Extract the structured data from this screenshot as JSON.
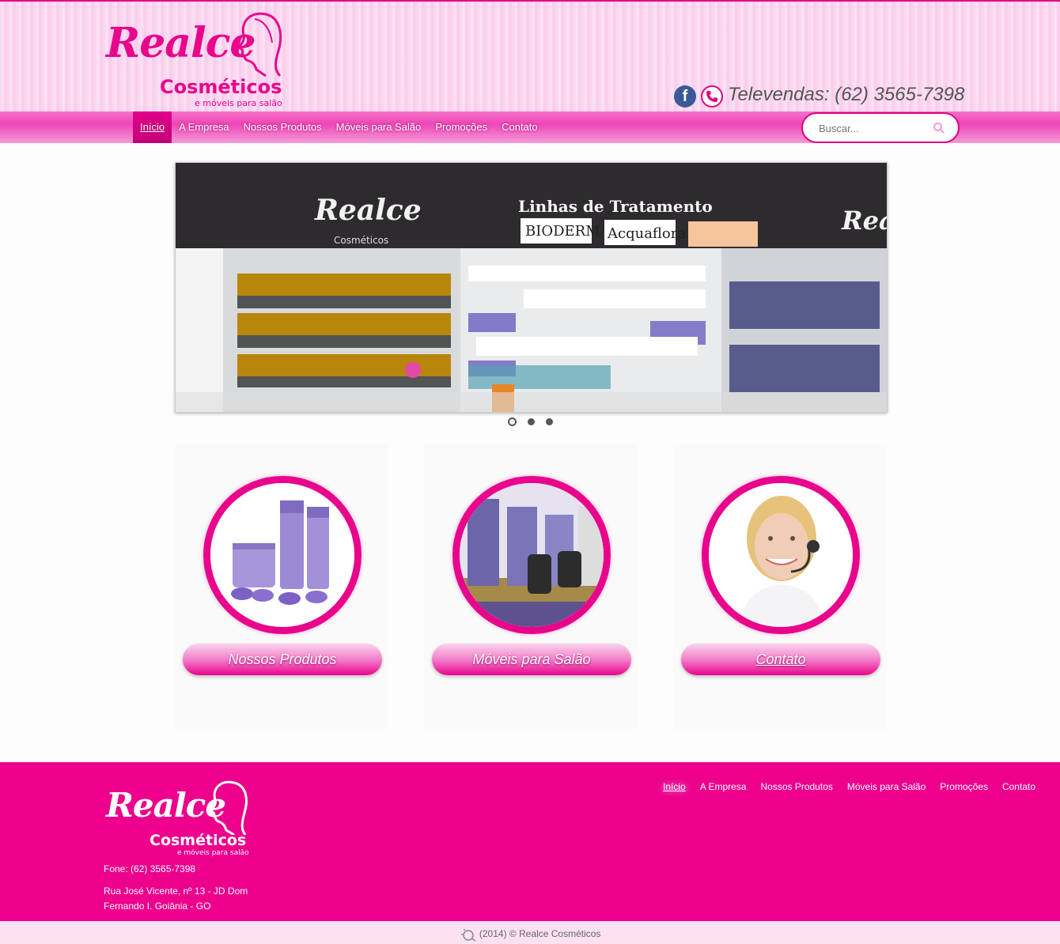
{
  "brand": {
    "name_script": "Realce",
    "name_sub": "Cosméticos",
    "tagline": "e móveis para salão"
  },
  "header": {
    "televendas": "Televendas: (62) 3565-7398",
    "icons": [
      "facebook-icon",
      "phone-icon"
    ],
    "search_placeholder": "Buscar..."
  },
  "nav": {
    "items": [
      {
        "label": "Início",
        "active": true
      },
      {
        "label": "A Empresa"
      },
      {
        "label": "Nossos Produtos"
      },
      {
        "label": "Móveis para Salão"
      },
      {
        "label": "Promoções"
      },
      {
        "label": "Contato"
      }
    ]
  },
  "slider": {
    "sign_title": "Linhas de Tratamento",
    "sign_brand": "Realce",
    "sign_brand_sub": "Cosméticos",
    "brand_1": "BIODERM",
    "brand_2": "Acquaflora",
    "slides": 3,
    "active_slide": 1
  },
  "features": [
    {
      "label": "Nossos Produtos"
    },
    {
      "label": "Móveis para Salão"
    },
    {
      "label": "Contato"
    }
  ],
  "footer": {
    "phone": "Fone: (62) 3565-7398",
    "address_1": "Rua José Vicente, nº 13 - JD Dom",
    "address_2": "Fernando I. Goiânia - GO",
    "nav": [
      "Início",
      "A Empresa",
      "Nossos Produtos",
      "Móveis para Salão",
      "Promoções",
      "Contato"
    ],
    "copyright": "(2014) © Realce Cosméticos"
  },
  "colors": {
    "accent": "#ec008c",
    "header_bg": "#fbd3ee",
    "copyright_bg": "#fbe1f2"
  }
}
